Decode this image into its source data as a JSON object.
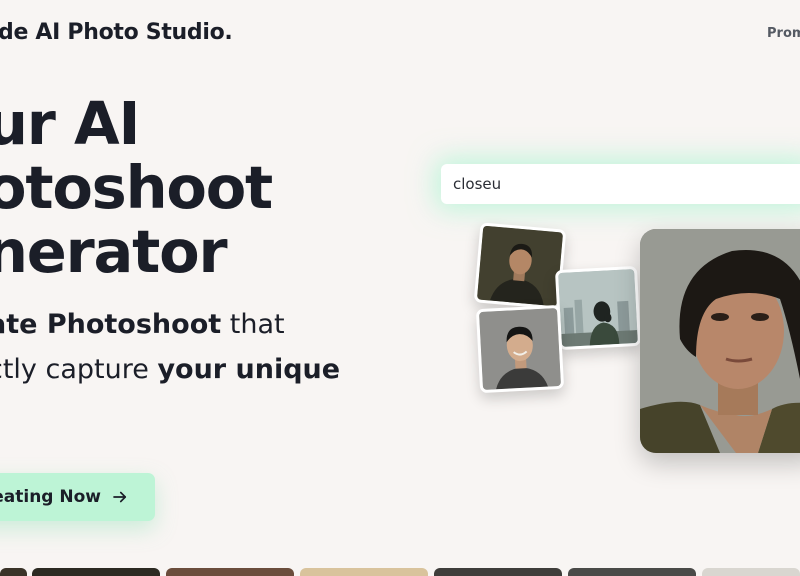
{
  "header": {
    "brand": "de AI Photo Studio.",
    "nav_item": "Prom"
  },
  "hero": {
    "headline": [
      "ur AI",
      "otoshoot",
      "nerator"
    ],
    "subhead_line1": {
      "bold": "ate Photoshoot",
      "rest": " that"
    },
    "subhead_line2": {
      "rest": "ctly capture ",
      "bold": "your unique"
    },
    "cta_label": "reating Now",
    "cta_icon": "arrow-right-icon"
  },
  "prompt": {
    "value": "closeu"
  },
  "colors": {
    "background": "#f8f5f3",
    "text": "#1b1e28",
    "accent": "#bdf4d6",
    "glow": "#96f5c8"
  },
  "gallery": {
    "thumbnails": [
      "portrait-man-dark-jacket",
      "woman-cityscape-back",
      "smiling-man-gray-backdrop"
    ],
    "main_image": "woman-portrait-closeup"
  }
}
